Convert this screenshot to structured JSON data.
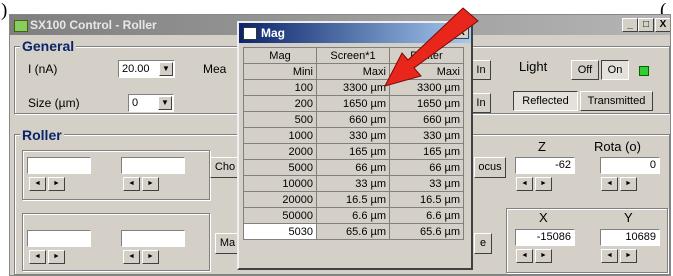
{
  "edge_fragments": {
    "left": ")",
    "right": "("
  },
  "window": {
    "title": "SX100 Control - Roller",
    "min": "_",
    "max": "□",
    "close": "X"
  },
  "general": {
    "label": "General",
    "current_label": "I (nA)",
    "current_value": "20.00",
    "size_label": "Size (µm)",
    "size_value": "0",
    "meas_label": "Mea",
    "light_label": "Light",
    "off": "Off",
    "on": "On",
    "reflected": "Reflected",
    "transmitted": "Transmitted",
    "in1": "In",
    "in2": "In"
  },
  "roller": {
    "label": "Roller",
    "cho_button": "Cho",
    "ma_button": "Ma",
    "focus_button": "ocus",
    "e_button": "e",
    "z_label": "Z",
    "z_value": "-62",
    "rota_label": "Rota (o)",
    "rota_value": "0",
    "x_label": "X",
    "x_value": "-15086",
    "y_label": "Y",
    "y_value": "10689"
  },
  "mag_dialog": {
    "title": "Mag",
    "close": "X",
    "headers": [
      "Mag",
      "Screen*1",
      "Printer"
    ],
    "subheaders": [
      "",
      "Mini",
      "Maxi",
      "Maxi"
    ],
    "rows": [
      [
        "100",
        "3300 µm",
        "3300 µm"
      ],
      [
        "200",
        "1650 µm",
        "1650 µm"
      ],
      [
        "500",
        "660 µm",
        "660 µm"
      ],
      [
        "1000",
        "330 µm",
        "330 µm"
      ],
      [
        "2000",
        "165 µm",
        "165 µm"
      ],
      [
        "5000",
        "66 µm",
        "66 µm"
      ],
      [
        "10000",
        "33 µm",
        "33 µm"
      ],
      [
        "20000",
        "16.5 µm",
        "16.5 µm"
      ],
      [
        "50000",
        "6.6 µm",
        "6.6 µm"
      ],
      [
        "5030",
        "65.6 µm",
        "65.6 µm"
      ]
    ]
  },
  "colors": {
    "arrow": "#e8261b",
    "title_inactive": "#8a8a8a",
    "title_active": "#0a246a",
    "led": "#33cc33"
  }
}
